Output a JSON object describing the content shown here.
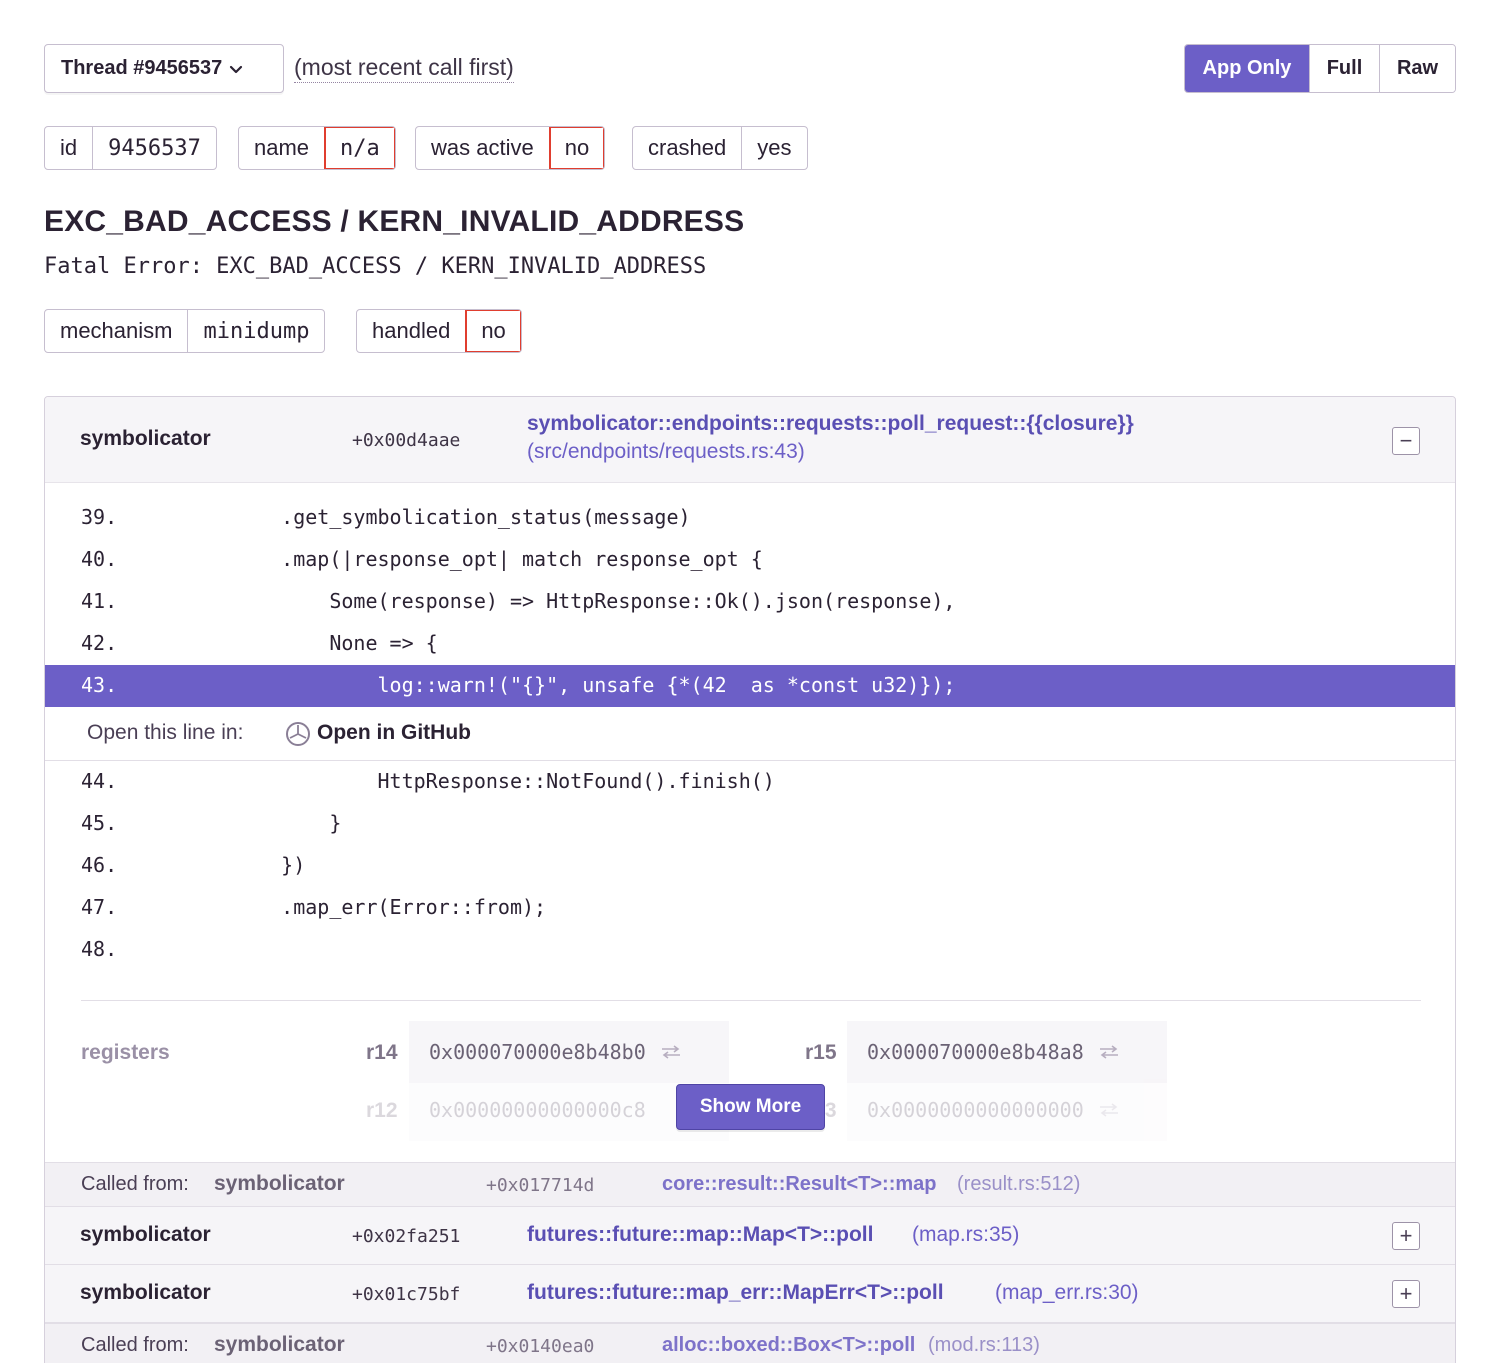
{
  "header": {
    "thread_label": "Thread #9456537",
    "recent_note": "(most recent call first)",
    "view_modes": [
      "App Only",
      "Full",
      "Raw"
    ],
    "active_view": "App Only"
  },
  "thread_tags": [
    {
      "key": "id",
      "value": "9456537"
    },
    {
      "key": "name",
      "value": "n/a"
    },
    {
      "key": "was active",
      "value": "no"
    },
    {
      "key": "crashed",
      "value": "yes"
    }
  ],
  "exception": {
    "title": "EXC_BAD_ACCESS / KERN_INVALID_ADDRESS",
    "value": "Fatal Error: EXC_BAD_ACCESS / KERN_INVALID_ADDRESS",
    "tags": [
      {
        "key": "mechanism",
        "value": "minidump"
      },
      {
        "key": "handled",
        "value": "no"
      }
    ]
  },
  "frames": {
    "expanded": {
      "package": "symbolicator",
      "address": "+0x00d4aae",
      "function": "symbolicator::endpoints::requests::poll_request::{{closure}}",
      "file": "(src/endpoints/requests.rs:43)",
      "toggle": "−",
      "code_before": [
        {
          "ln": "39.",
          "src": "    .get_symbolication_status(message)"
        },
        {
          "ln": "40.",
          "src": "    .map(|response_opt| match response_opt {"
        },
        {
          "ln": "41.",
          "src": "        Some(response) => HttpResponse::Ok().json(response),"
        },
        {
          "ln": "42.",
          "src": "        None => {"
        },
        {
          "ln": "43.",
          "src": "            log::warn!(\"{}\", unsafe {*(42  as *const u32)});"
        }
      ],
      "open_line_label": "Open this line in:",
      "open_in_github": "Open in GitHub",
      "code_after": [
        {
          "ln": "44.",
          "src": "            HttpResponse::NotFound().finish()"
        },
        {
          "ln": "45.",
          "src": "        }"
        },
        {
          "ln": "46.",
          "src": "    })"
        },
        {
          "ln": "47.",
          "src": "    .map_err(Error::from);"
        },
        {
          "ln": "48.",
          "src": ""
        }
      ],
      "registers_label": "registers",
      "registers": [
        {
          "name": "r14",
          "value": "0x000070000e8b48b0"
        },
        {
          "name": "r15",
          "value": "0x000070000e8b48a8"
        },
        {
          "name": "r12",
          "value": "0x00000000000000c8"
        },
        {
          "name": "r13",
          "value": "0x0000000000000000"
        }
      ],
      "show_more": "Show More"
    },
    "called_from_label": "Called from:",
    "called_from_1": {
      "package": "symbolicator",
      "address": "+0x017714d",
      "function": "core::result::Result<T>::map",
      "file": "(result.rs:512)"
    },
    "collapsed_1": {
      "package": "symbolicator",
      "address": "+0x02fa251",
      "function": "futures::future::map::Map<T>::poll",
      "file": "(map.rs:35)",
      "toggle": "+"
    },
    "collapsed_2": {
      "package": "symbolicator",
      "address": "+0x01c75bf",
      "function": "futures::future::map_err::MapErr<T>::poll",
      "file": "(map_err.rs:30)",
      "toggle": "+"
    },
    "called_from_2": {
      "package": "symbolicator",
      "address": "+0x0140ea0",
      "function": "alloc::boxed::Box<T>::poll",
      "file": "(mod.rs:113)"
    }
  },
  "colors": {
    "accent": "#6c5fc7",
    "warning_border": "#e03e2f",
    "text": "#2b2233"
  }
}
